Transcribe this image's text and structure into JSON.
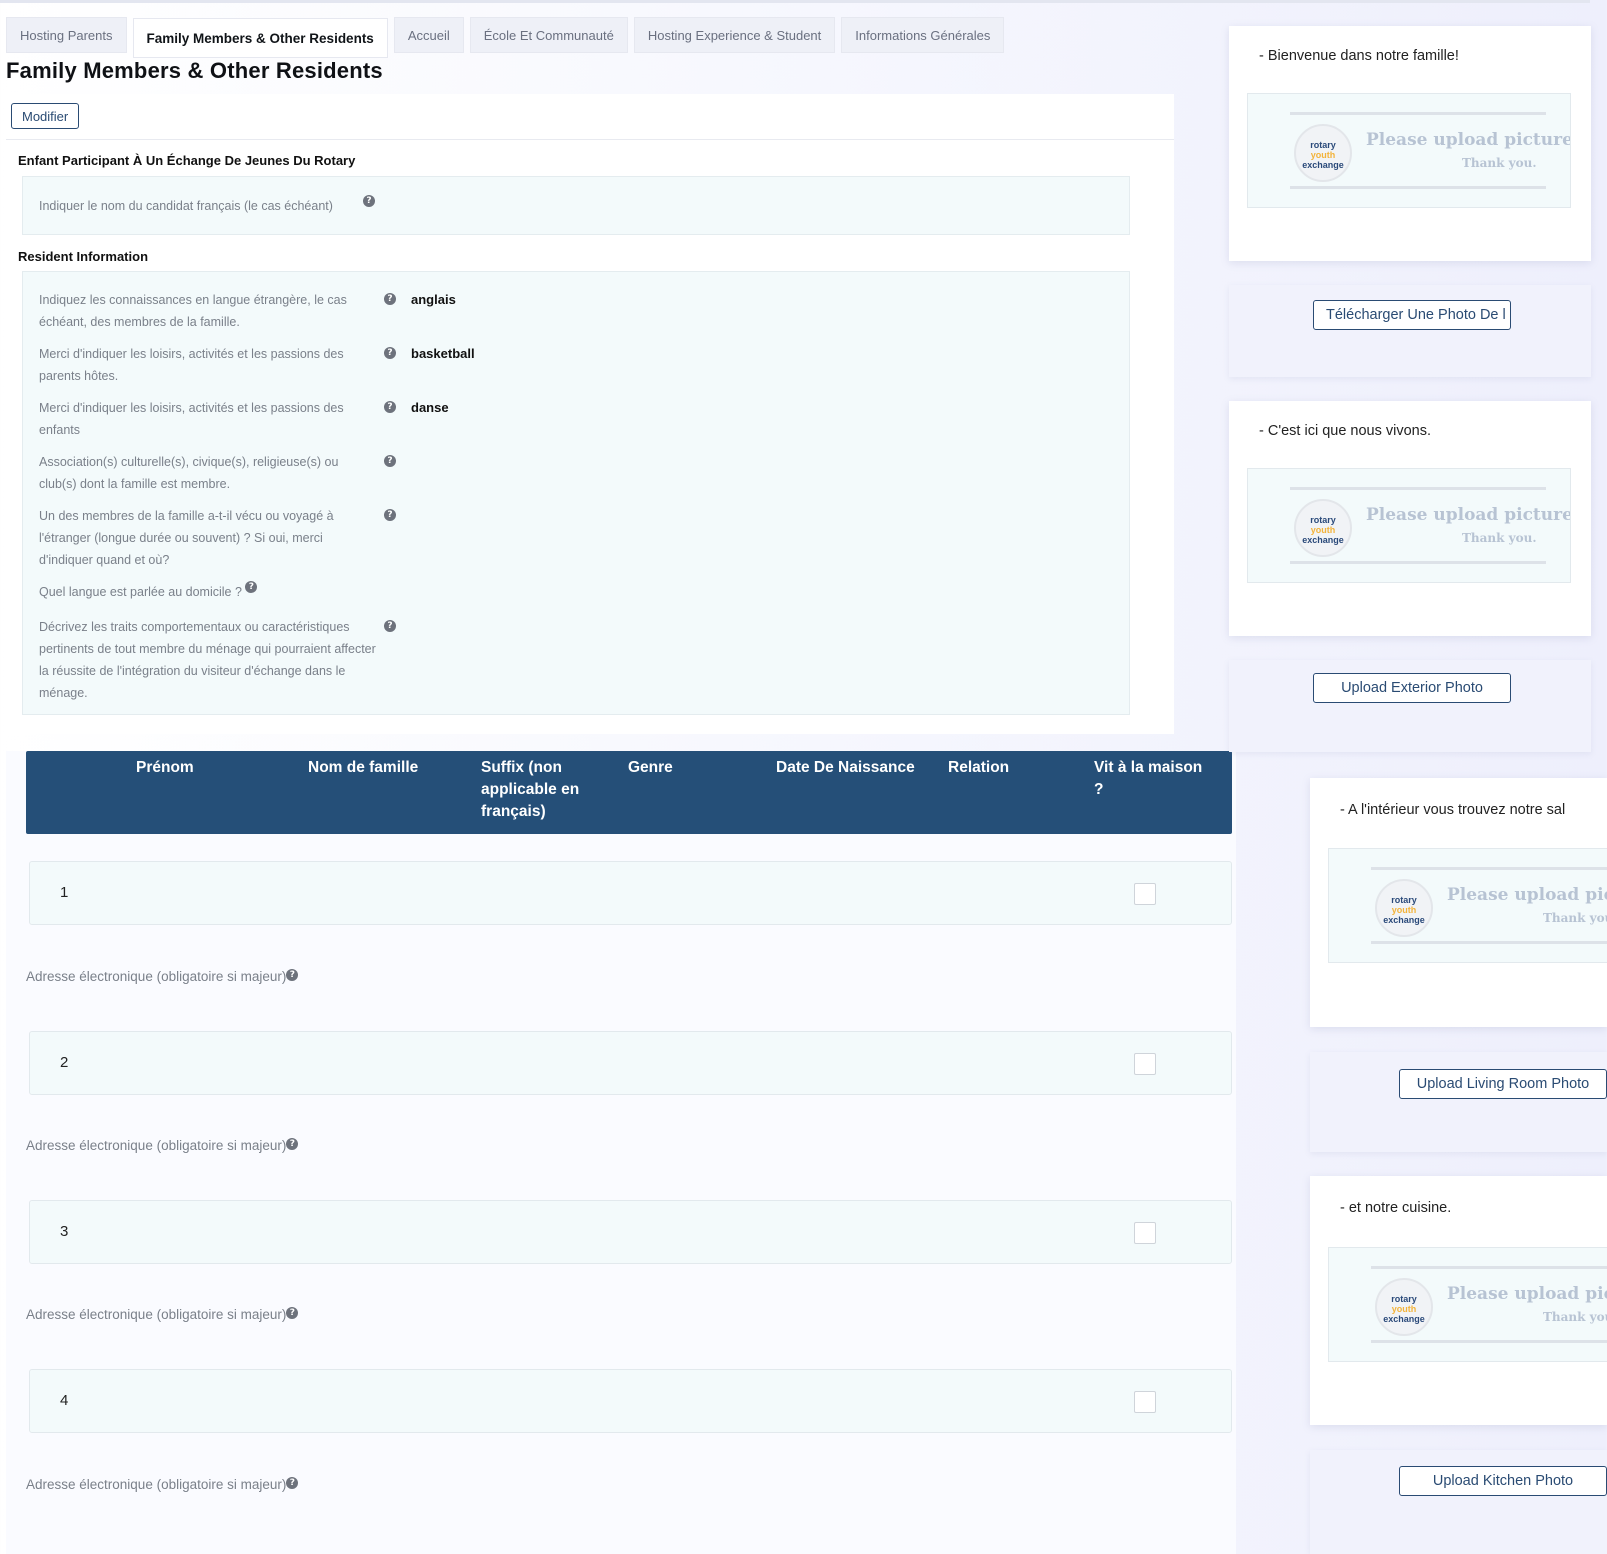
{
  "tabs": [
    {
      "label": "Hosting Parents"
    },
    {
      "label": "Family Members & Other Residents"
    },
    {
      "label": "Accueil"
    },
    {
      "label": "École Et Communauté"
    },
    {
      "label": "Hosting Experience & Student"
    },
    {
      "label": "Informations Générales"
    }
  ],
  "active_tab": "Family Members & Other Residents",
  "page_title": "Family Members & Other Residents",
  "modifier_label": "Modifier",
  "exchange": {
    "title": "Enfant Participant À Un Échange De Jeunes Du Rotary",
    "candidate_label": "Indiquer le nom du candidat français (le cas échéant)"
  },
  "resident": {
    "title": "Resident Information",
    "rows": [
      {
        "label": "Indiquez les connaissances en langue étrangère, le cas échéant, des membres de la famille.",
        "value": "anglais"
      },
      {
        "label": "Merci d'indiquer les loisirs, activités et les passions des parents hôtes.",
        "value": "basketball"
      },
      {
        "label": "Merci d'indiquer les loisirs, activités et les passions des enfants",
        "value": "danse"
      },
      {
        "label": "Association(s) culturelle(s), civique(s), religieuse(s) ou club(s) dont la famille est membre.",
        "value": ""
      },
      {
        "label": "Un des membres de la famille a-t-il vécu ou voyagé à l'étranger (longue durée ou souvent) ? Si oui, merci d'indiquer quand et où?",
        "value": ""
      },
      {
        "label": "Quel langue est parlée au domicile ?",
        "value": ""
      },
      {
        "label": "Décrivez les traits comportementaux ou caractéristiques pertinents de tout membre du ménage qui pourraient affecter la réussite de l'intégration du visiteur d'échange dans le ménage.",
        "value": ""
      }
    ]
  },
  "table": {
    "headers": [
      "Prénom",
      "Nom de famille",
      "Suffix (non applicable en français)",
      "Genre",
      "Date De Naissance",
      "Relation",
      "Vit à la maison ?"
    ],
    "rows": [
      {
        "num": "1",
        "lives_home": false
      },
      {
        "num": "2",
        "lives_home": false
      },
      {
        "num": "3",
        "lives_home": false
      },
      {
        "num": "4",
        "lives_home": false
      }
    ],
    "email_label": "Adresse électronique (obligatoire si majeur)"
  },
  "photos": [
    {
      "caption": "- Bienvenue dans notre famille!",
      "button": "Télécharger Une Photo De l"
    },
    {
      "caption": "- C'est ici que nous vivons.",
      "button": "Upload Exterior Photo"
    },
    {
      "caption": "- A l'intérieur vous trouvez notre sal",
      "button": "Upload Living Room Photo"
    },
    {
      "caption": "- et notre cuisine.",
      "button": "Upload Kitchen Photo"
    }
  ],
  "placeholder": {
    "text": "Please upload picture.",
    "sub": "Thank you.",
    "logo": [
      "rotary",
      "youth",
      "exchange"
    ]
  },
  "colors": {
    "table_header": "#254f78",
    "button_border": "#2a4b73",
    "field_bg": "#f3fafb"
  }
}
